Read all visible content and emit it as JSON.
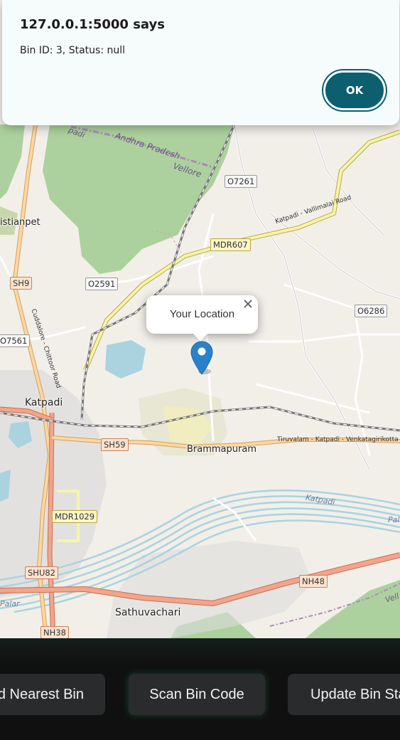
{
  "alert": {
    "title": "127.0.0.1:5000 says",
    "message": "Bin ID: 3, Status: null",
    "ok_label": "OK"
  },
  "map": {
    "popup_text": "Your Location",
    "labels": {
      "andhra_pradesh": "Andhra Pradesh",
      "vellore": "Vellore",
      "christianpet": "istianpet",
      "katpadi_town": "Katpadi",
      "brammapuram": "Brammapuram",
      "sathuvachari": "Sathuvachari",
      "katpadi_vallimalai_road": "Katpadi - Vallimalai Road",
      "cuddalore_road": "Cuddalore - Chittoor Road",
      "tiruvalam_road": "Tiruvalam - Katpadi - Venkatagirikotta",
      "katpadi_river": "Katpadi",
      "palar_east": "Pal",
      "palar_west": "Palar",
      "vell_east": "Vell",
      "padi_top": "padi"
    },
    "shields": {
      "o7261": "O7261",
      "mdr607": "MDR607",
      "sh9": "SH9",
      "o2591": "O2591",
      "o6286": "O6286",
      "o7561": "O7561",
      "sh59": "SH59",
      "mdr1029": "MDR1029",
      "shu82": "SHU82",
      "nh48": "NH48",
      "nh38": "NH38"
    },
    "icons": {
      "marker": "map-marker-icon",
      "close": "close-icon"
    },
    "colors": {
      "marker": "#2a81cb",
      "water": "#aad3df",
      "forest": "#add19e",
      "background": "#f2efe9"
    }
  },
  "bottom_bar": {
    "find_label": "d Nearest Bin",
    "scan_label": "Scan Bin Code",
    "update_label": "Update Bin Sta"
  }
}
